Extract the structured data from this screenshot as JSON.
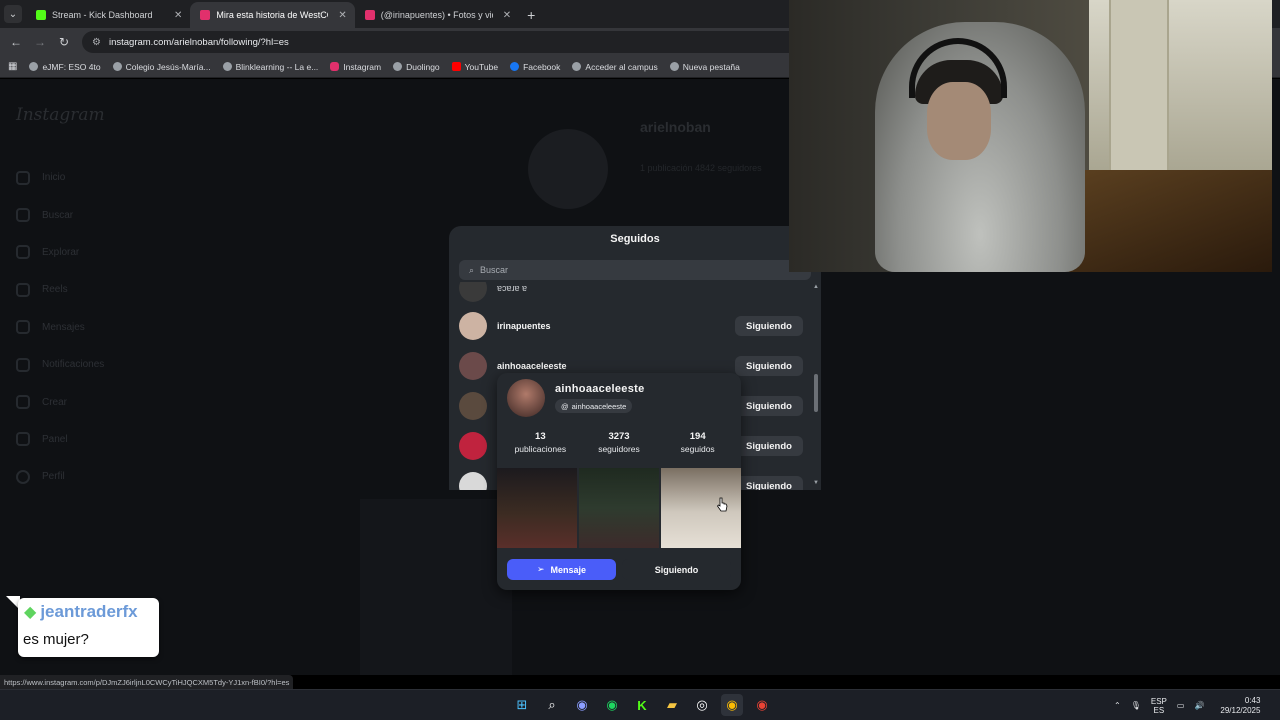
{
  "browser": {
    "tabs": [
      {
        "title": "Stream - Kick Dashboard",
        "favicon_color": "#53fc18",
        "active": false
      },
      {
        "title": "Mira esta historia de WestCOL",
        "favicon_color": "#e1306c",
        "active": true
      },
      {
        "title": "(@irinapuentes) • Fotos y videos",
        "favicon_color": "#e1306c",
        "active": false
      }
    ],
    "new_tab_glyph": "+",
    "url": "instagram.com/arielnoban/following/?hl=es",
    "bookmarks": [
      {
        "label": "eJMF: ESO 4to",
        "icon": "globe-icon",
        "color": "#9aa0a6"
      },
      {
        "label": "Colegio Jesús-María...",
        "icon": "globe-icon",
        "color": "#9aa0a6"
      },
      {
        "label": "Blinklearning -- La e...",
        "icon": "globe-icon",
        "color": "#9aa0a6"
      },
      {
        "label": "Instagram",
        "icon": "instagram-icon",
        "color": "#e1306c"
      },
      {
        "label": "Duolingo",
        "icon": "globe-icon",
        "color": "#9aa0a6"
      },
      {
        "label": "YouTube",
        "icon": "youtube-icon",
        "color": "#ff0000"
      },
      {
        "label": "Facebook",
        "icon": "facebook-icon",
        "color": "#1877f2"
      },
      {
        "label": "Acceder al campus",
        "icon": "globe-icon",
        "color": "#9aa0a6"
      },
      {
        "label": "Nueva pestaña",
        "icon": "globe-icon",
        "color": "#9aa0a6"
      }
    ]
  },
  "instagram": {
    "logo": "Instagram",
    "nav": [
      "Inicio",
      "Buscar",
      "Explorar",
      "Reels",
      "Mensajes",
      "Notificaciones",
      "Crear",
      "Panel",
      "Perfil"
    ],
    "profile_name": "arielnoban",
    "profile_stats": "1 publicación   4842 seguidores"
  },
  "modal": {
    "title": "Seguidos",
    "search_placeholder": "Buscar",
    "users": [
      {
        "username": "ɐɔɐɹɐ ɐ",
        "button": "",
        "avatar_color": "#3a3a3a"
      },
      {
        "username": "irinapuentes",
        "button": "Siguiendo",
        "avatar_color": "#cdb3a3"
      },
      {
        "username": "ainhoaaceleeste",
        "button": "Siguiendo",
        "avatar_color": "#6b4a4a"
      },
      {
        "username": "",
        "button": "Siguiendo",
        "avatar_color": "#5a4a3e"
      },
      {
        "username": "",
        "button": "Siguiendo",
        "avatar_color": "#c0233e"
      },
      {
        "username": "",
        "button": "Siguiendo",
        "avatar_color": "#d9d9d9"
      }
    ]
  },
  "hovercard": {
    "username": "ainhoaaceleeste",
    "threads_handle": "ainhoaaceleeste",
    "stats": [
      {
        "num": "13",
        "label": "publicaciones"
      },
      {
        "num": "3273",
        "label": "seguidores"
      },
      {
        "num": "194",
        "label": "seguidos"
      }
    ],
    "photo_colors": [
      "#3b2b22",
      "#2e3b2e",
      "#cfc8bd"
    ],
    "message_button": "Mensaje",
    "following_button": "Siguiendo",
    "accent_color": "#4a5df9"
  },
  "chat": {
    "user": "jeantraderfx",
    "message": "es mujer?"
  },
  "status_url": "https://www.instagram.com/p/DJmZJ6irljnL0CWCyTiHJQCXM5Tdy-YJ1xn-fBI0/?hl=es",
  "taskbar": {
    "apps": [
      "windows-start-icon",
      "search-icon",
      "discord-icon",
      "spotify-icon",
      "kick-icon",
      "file-explorer-icon",
      "obs-icon",
      "chrome-icon",
      "chrome-alt-icon"
    ],
    "lang_top": "ESP",
    "lang_bottom": "ES",
    "time": "0:43",
    "date": "29/12/2025"
  }
}
